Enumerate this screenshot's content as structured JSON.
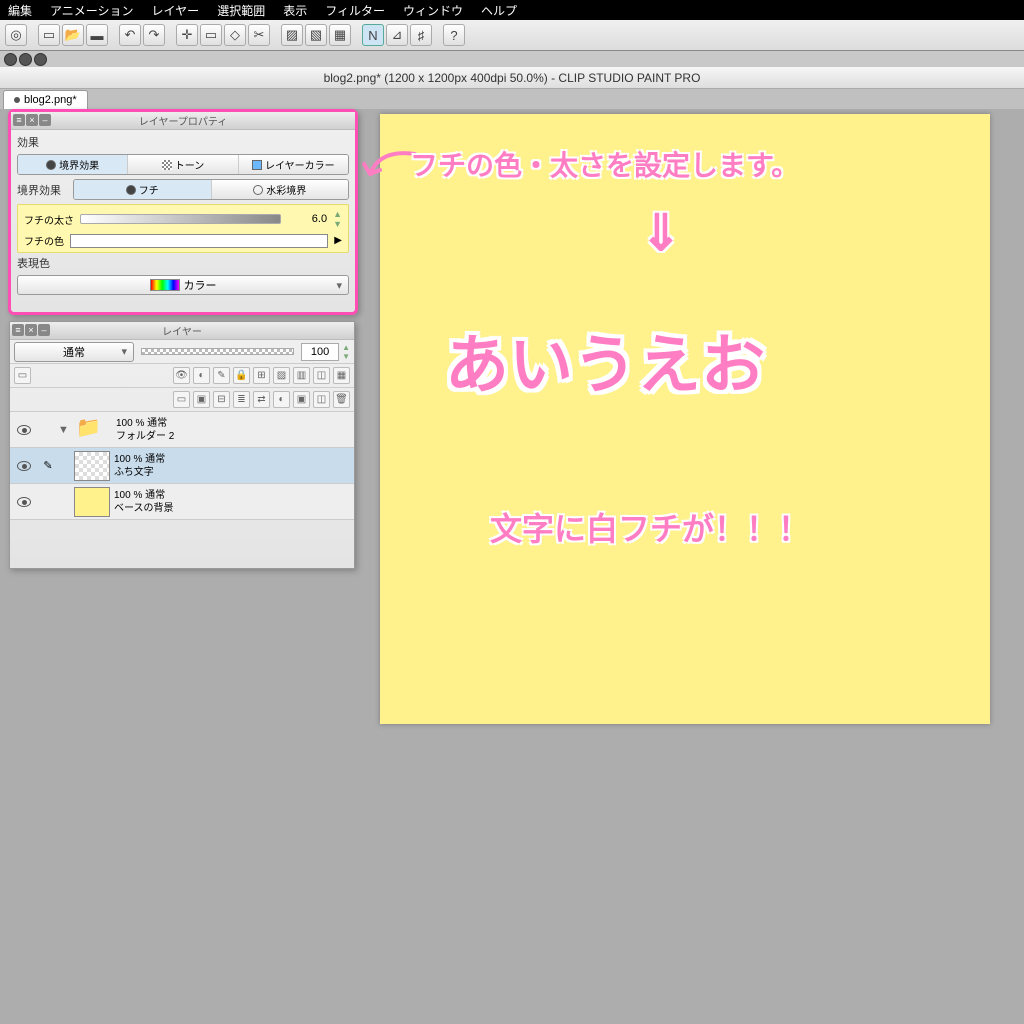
{
  "menu": [
    "編集",
    "アニメーション",
    "レイヤー",
    "選択範囲",
    "表示",
    "フィルター",
    "ウィンドウ",
    "ヘルプ"
  ],
  "title": "blog2.png* (1200 x 1200px 400dpi 50.0%)  - CLIP STUDIO PAINT PRO",
  "tab": "blog2.png*",
  "prop": {
    "title": "レイヤープロパティ",
    "section_effect": "効果",
    "border_effect": "境界効果",
    "tone": "トーン",
    "layer_color": "レイヤーカラー",
    "edge": "フチ",
    "watercolor": "水彩境界",
    "thickness_label": "フチの太さ",
    "thickness_val": "6.0",
    "color_label": "フチの色",
    "expression": "表現色",
    "expression_val": "カラー"
  },
  "layer": {
    "title": "レイヤー",
    "blend": "通常",
    "opacity": "100",
    "folder": {
      "opacity": "100 %",
      "mode": "通常",
      "name": "フォルダー 2"
    },
    "l1": {
      "opacity": "100 %",
      "mode": "通常",
      "name": "ふち文字"
    },
    "l2": {
      "opacity": "100 %",
      "mode": "通常",
      "name": "ベースの背景"
    }
  },
  "anno": {
    "a1": "フチの色・太さを設定します。",
    "a2": "⇓",
    "a3": "あいうえお",
    "a4": "文字に白フチが！！！"
  }
}
